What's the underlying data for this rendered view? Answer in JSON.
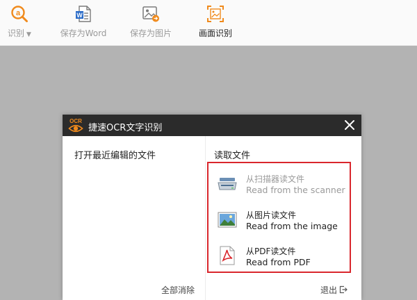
{
  "toolbar": {
    "items": [
      {
        "label": "识别",
        "icon": "recognize-icon",
        "has_dropdown": true
      },
      {
        "label": "保存为Word",
        "icon": "word-icon"
      },
      {
        "label": "保存为图片",
        "icon": "save-image-icon"
      },
      {
        "label": "画面识别",
        "icon": "screen-capture-icon",
        "active": true
      }
    ],
    "dropdown_caret": "▼"
  },
  "dialog": {
    "logo_text": "OCR",
    "title": "捷速OCR文字识别",
    "close_glyph": "✕",
    "left": {
      "heading": "打开最近编辑的文件",
      "clear_all": "全部消除"
    },
    "right": {
      "heading": "读取文件",
      "sources": [
        {
          "cn": "从扫描器读文件",
          "en": "Read from the scanner",
          "icon": "scanner-icon",
          "enabled": false
        },
        {
          "cn": "从图片读文件",
          "en": "Read from the image",
          "icon": "image-file-icon",
          "enabled": true
        },
        {
          "cn": "从PDF读文件",
          "en": "Read from PDF",
          "icon": "pdf-icon",
          "enabled": true
        }
      ],
      "exit": "退出"
    }
  },
  "colors": {
    "accent": "#f08a1c",
    "highlight_border": "#d9262c",
    "titlebar": "#2b2b2b",
    "backdrop": "#b3b3b3"
  }
}
